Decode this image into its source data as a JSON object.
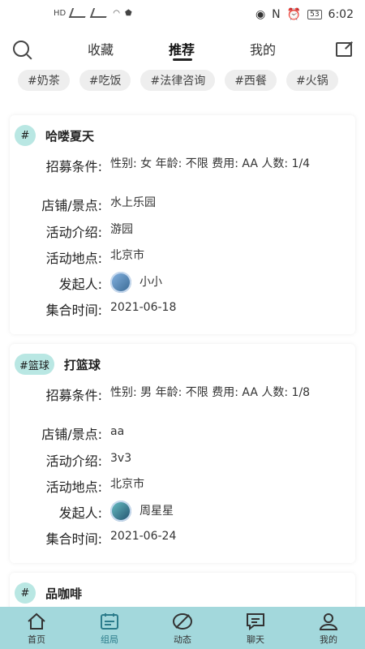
{
  "status": {
    "time": "6:02",
    "battery": "53"
  },
  "topnav": {
    "tabs": [
      {
        "label": "收藏"
      },
      {
        "label": "推荐"
      },
      {
        "label": "我的"
      }
    ]
  },
  "tags": [
    "#奶茶",
    "#吃饭",
    "#法律咨询",
    "#西餐",
    "#火锅"
  ],
  "cards": [
    {
      "badge": "#",
      "title": "哈喽夏天",
      "fields": {
        "recruit_label": "招募条件:",
        "recruit_value": "性别: 女 年龄: 不限 费用: AA 人数: 1/4",
        "store_label": "店铺/景点:",
        "store_value": "水上乐园",
        "intro_label": "活动介绍:",
        "intro_value": "游园",
        "place_label": "活动地点:",
        "place_value": "北京市",
        "initiator_label": "发起人:",
        "initiator_value": "小小",
        "time_label": "集合时间:",
        "time_value": "2021-06-18"
      }
    },
    {
      "badge": "#篮球",
      "title": "打篮球",
      "fields": {
        "recruit_label": "招募条件:",
        "recruit_value": "性别: 男 年龄: 不限 费用: AA 人数: 1/8",
        "store_label": "店铺/景点:",
        "store_value": "aa",
        "intro_label": "活动介绍:",
        "intro_value": "3v3",
        "place_label": "活动地点:",
        "place_value": "北京市",
        "initiator_label": "发起人:",
        "initiator_value": "周星星",
        "time_label": "集合时间:",
        "time_value": "2021-06-24"
      }
    },
    {
      "badge": "#",
      "title": "品咖啡"
    }
  ],
  "bottom_nav": [
    {
      "label": "首页",
      "icon": "home-icon"
    },
    {
      "label": "组局",
      "icon": "calendar-icon"
    },
    {
      "label": "动态",
      "icon": "leaf-icon"
    },
    {
      "label": "聊天",
      "icon": "chat-icon"
    },
    {
      "label": "我的",
      "icon": "profile-icon"
    }
  ],
  "colors": {
    "accent": "#a3d8dc",
    "badge": "#b9e7e3",
    "active": "#2b7c8b"
  }
}
